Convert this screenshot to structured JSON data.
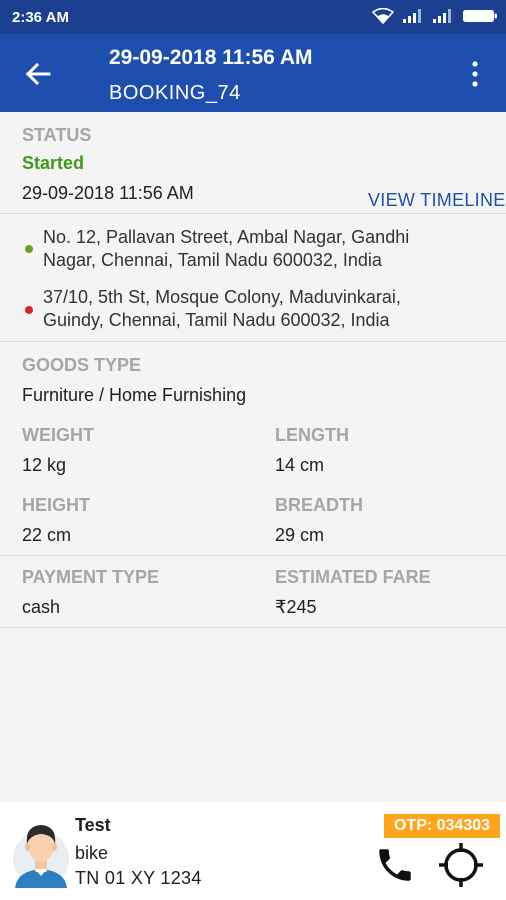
{
  "status_bar": {
    "time": "2:36 AM"
  },
  "app_bar": {
    "title": "29-09-2018 11:56 AM",
    "subtitle": "BOOKING_74",
    "back_icon": "arrow-left-icon",
    "menu_icon": "more-vertical-icon"
  },
  "status_section": {
    "label": "STATUS",
    "status": "Started",
    "datetime": "29-09-2018 11:56 AM",
    "timeline_link": "VIEW TIMELINE"
  },
  "addresses": {
    "pickup": "No. 12, Pallavan Street, Ambal Nagar, Gandhi Nagar, Chennai, Tamil Nadu 600032, India",
    "drop": "37/10, 5th St, Mosque Colony, Maduvinkarai, Guindy, Chennai, Tamil Nadu 600032, India",
    "pickup_color": "#6aa01e",
    "drop_color": "#d62828"
  },
  "goods": {
    "type_label": "GOODS TYPE",
    "type_value": "Furniture / Home Furnishing",
    "weight_label": "WEIGHT",
    "weight_value": "12 kg",
    "length_label": "LENGTH",
    "length_value": "14 cm",
    "height_label": "HEIGHT",
    "height_value": "22 cm",
    "breadth_label": "BREADTH",
    "breadth_value": "29 cm"
  },
  "payment": {
    "type_label": "PAYMENT TYPE",
    "type_value": "cash",
    "fare_label": "ESTIMATED FARE",
    "fare_value": "₹245"
  },
  "driver": {
    "name": "Test",
    "vehicle": "bike",
    "plate": "TN 01 XY 1234",
    "otp": "OTP: 034303",
    "call_icon": "phone-icon",
    "locate_icon": "crosshair-icon"
  },
  "colors": {
    "primary": "#1f4fae",
    "status_bar": "#1c3f8f",
    "started": "#3f9a1a",
    "otp_bg": "#ffa41b"
  }
}
